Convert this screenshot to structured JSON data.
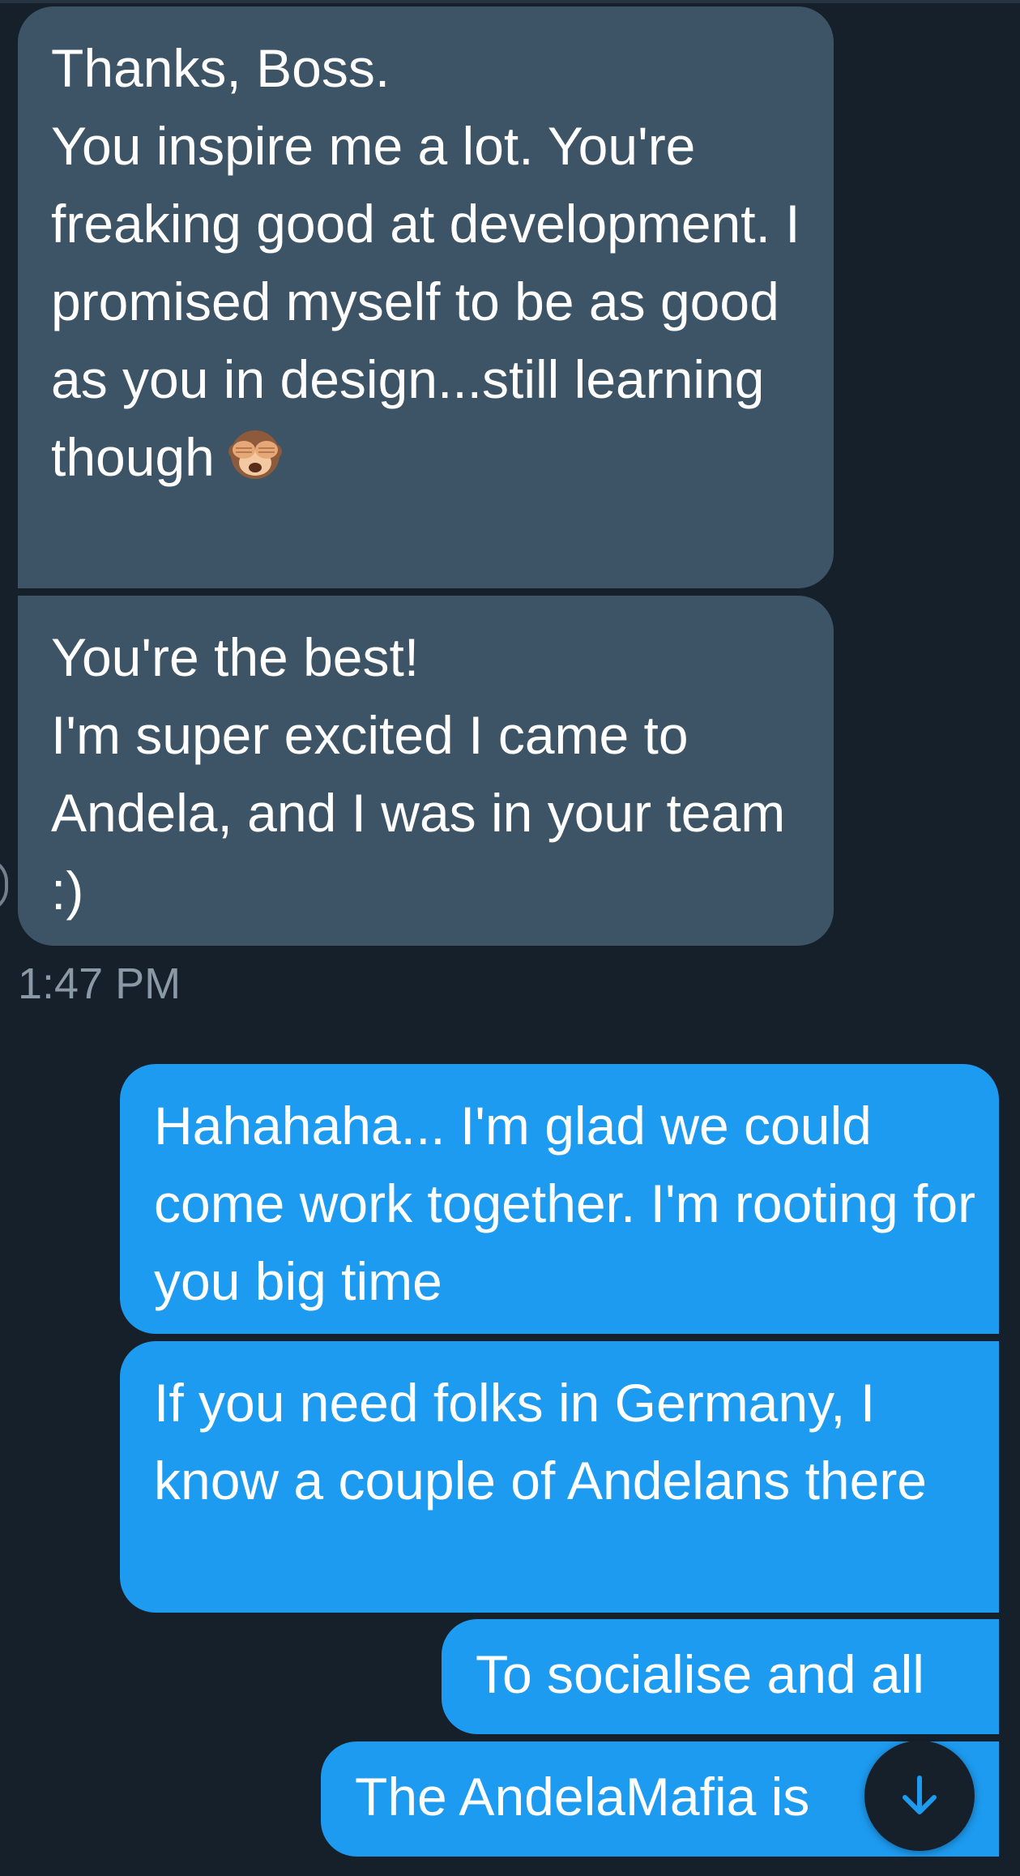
{
  "conversation": {
    "incoming": [
      {
        "text": "Thanks, Boss.\nYou inspire me a lot. You're freaking good at development. I promised myself to be as good as you in design...still learning though",
        "emoji": "see-no-evil-monkey-emoji"
      },
      {
        "text": "You're the best!\nI'm super excited I came to Andela, and I was in your team :)"
      }
    ],
    "incoming_timestamp": "1:47 PM",
    "outgoing": [
      {
        "text": "Hahahaha... I'm glad we could come work together. I'm rooting for you big time"
      },
      {
        "text": "If you need folks in Germany, I know a couple of Andelans there"
      },
      {
        "text": "To socialise and all"
      },
      {
        "text": "The AndelaMafia is"
      }
    ]
  },
  "scroll_button": {
    "icon": "arrow-down-icon"
  },
  "colors": {
    "background": "#15202b",
    "incoming_bubble": "#3d5466",
    "outgoing_bubble": "#1d9bf0",
    "timestamp_text": "#8b98a5",
    "accent": "#1d9bf0"
  }
}
